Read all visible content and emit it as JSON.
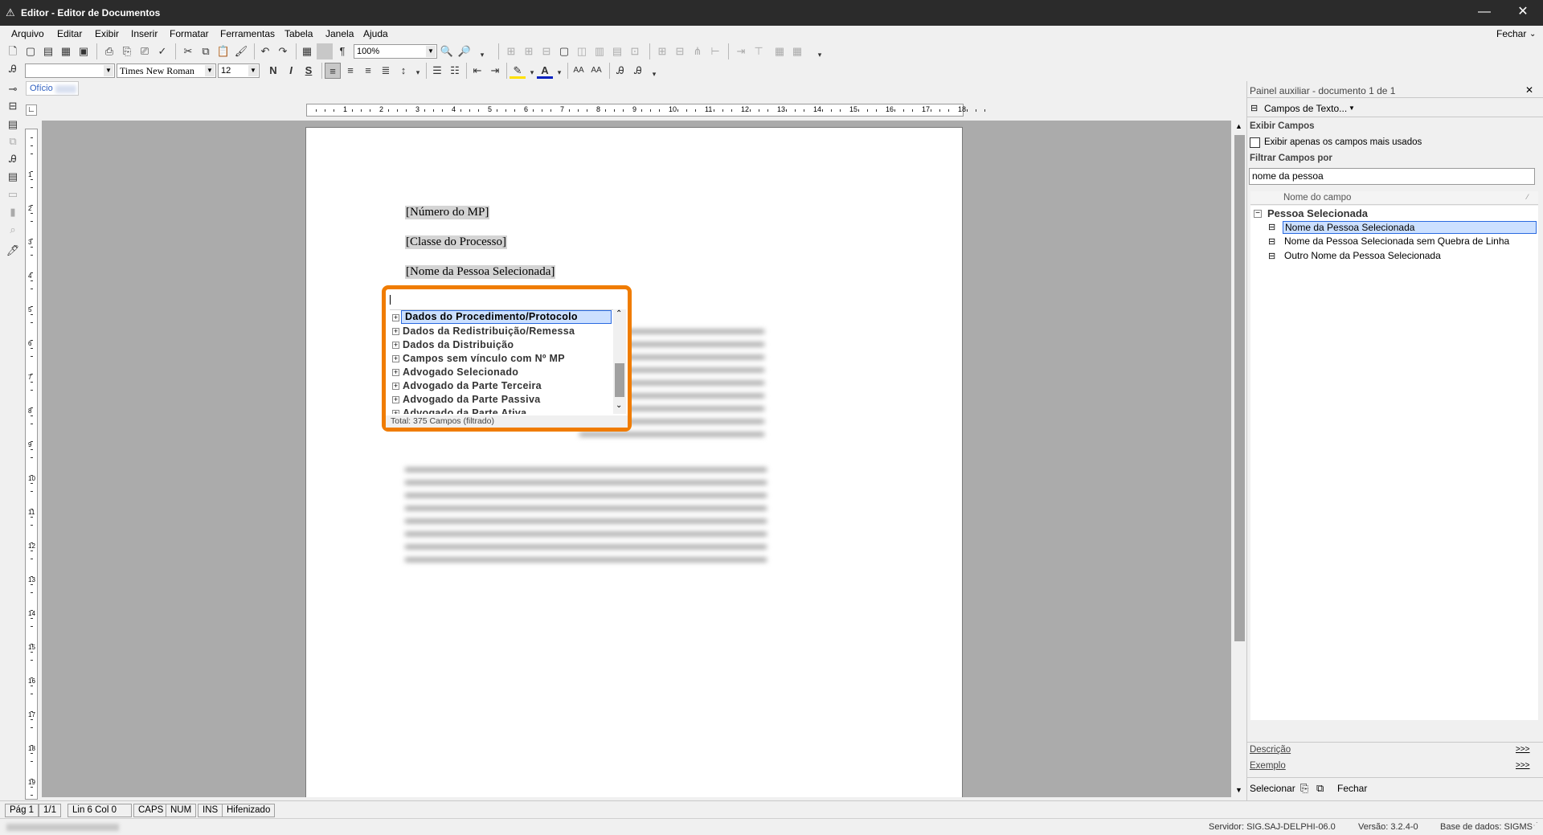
{
  "window": {
    "title": "Editor - Editor de Documentos",
    "minimize": "—",
    "close": "✕"
  },
  "menu": {
    "items": [
      "Arquivo",
      "Editar",
      "Exibir",
      "Inserir",
      "Formatar",
      "Ferramentas",
      "Tabela",
      "Janela",
      "Ajuda"
    ],
    "fechar": "Fechar"
  },
  "toolbar": {
    "zoom": "100%",
    "font": "Times New Roman",
    "size": "12"
  },
  "doc_tab": {
    "label": "Ofício"
  },
  "document": {
    "fields": [
      "[Número do MP]",
      "[Classe do Processo]",
      "[Nome da Pessoa Selecionada]"
    ]
  },
  "popup": {
    "items": [
      "Dados do Procedimento/Protocolo",
      "Dados da Redistribuição/Remessa",
      "Dados da Distribuição",
      "Campos sem vínculo com Nº MP",
      "Advogado Selecionado",
      "Advogado da Parte Terceira",
      "Advogado da Parte Passiva",
      "Advogado da Parte Ativa"
    ],
    "footer": "Total: 375 Campos (filtrado)"
  },
  "panel": {
    "title": "Painel auxiliar - documento 1 de 1",
    "close": "✕",
    "dropdown": "Campos de Texto...",
    "exibir_campos": "Exibir Campos",
    "checkbox_label": "Exibir apenas os campos mais usados",
    "filtrar": "Filtrar Campos por",
    "filter_value": "nome da pessoa",
    "column": "Nome do campo",
    "group": "Pessoa Selecionada",
    "nodes": [
      "Nome da Pessoa Selecionada",
      "Nome da Pessoa Selecionada sem Quebra de Linha",
      "Outro Nome da Pessoa Selecionada"
    ],
    "descricao": "Descrição",
    "exemplo": "Exemplo",
    "more": ">>>",
    "selecionar": "Selecionar",
    "fechar": "Fechar"
  },
  "status": {
    "pag": "Pág 1",
    "of": "1/1",
    "lin": "Lin 6  Col 0",
    "caps": "CAPS",
    "num": "NUM",
    "ins": "INS",
    "hif": "Hifenizado"
  },
  "info": {
    "servidor": "Servidor: SIG.SAJ-DELPHI-06.0",
    "versao": "Versão: 3.2.4-0",
    "base": "Base de dados: SIGMS"
  },
  "colors": {
    "accent": "#f07c00",
    "selection": "#cce0ff"
  }
}
